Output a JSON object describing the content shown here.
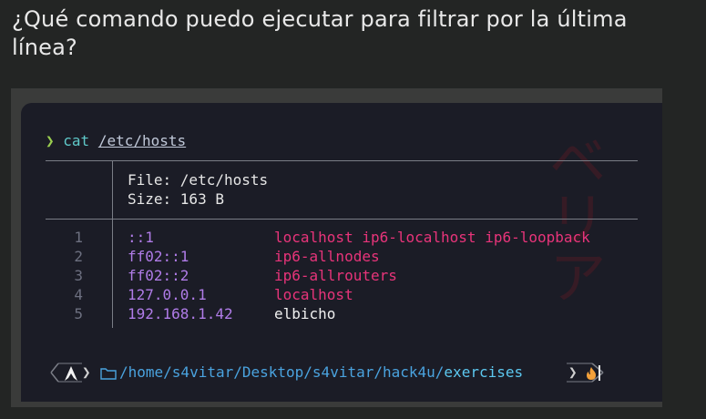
{
  "question": {
    "text": "¿Qué comando puedo ejecutar para filtrar por la última línea?"
  },
  "terminal": {
    "command": {
      "prompt_symbol": "❯",
      "program": "cat",
      "argument": "/etc/hosts"
    },
    "file_header": {
      "file_line": "File: /etc/hosts",
      "size_line": "Size: 163 B"
    },
    "lines": [
      {
        "num": "1",
        "ip": "::1",
        "hosts": "localhost ip6-localhost ip6-loopback",
        "highlight": true
      },
      {
        "num": "2",
        "ip": "ff02::1",
        "hosts": "ip6-allnodes",
        "highlight": true
      },
      {
        "num": "3",
        "ip": "ff02::2",
        "hosts": "ip6-allrouters",
        "highlight": true
      },
      {
        "num": "4",
        "ip": "127.0.0.1",
        "hosts": "localhost",
        "highlight": true
      },
      {
        "num": "5",
        "ip": "192.168.1.42",
        "hosts": "elbicho",
        "highlight": false
      }
    ],
    "statusbar": {
      "os_icon": "arch-linux-icon",
      "folder_icon": "folder-icon",
      "path_prefix": "/home/s4vitar/Desktop/s4vitar/hack4u/",
      "path_last": "exercises",
      "status_icon": "fire-icon"
    }
  },
  "colors": {
    "page_bg": "#232524",
    "terminal_bg": "#1b1c26",
    "ip_color": "#b07ce8",
    "host_color": "#e8347a",
    "path_color": "#4aa3df"
  }
}
